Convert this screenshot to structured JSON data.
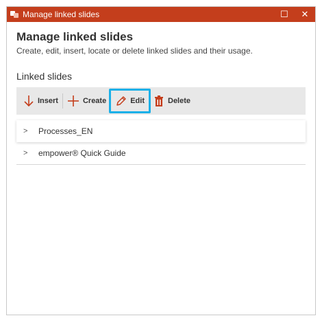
{
  "window": {
    "title": "Manage linked slides",
    "maximize_glyph": "☐",
    "close_glyph": "✕"
  },
  "dialog": {
    "heading": "Manage linked slides",
    "description": "Create, edit, insert, locate or delete linked slides and their usage.",
    "section_label": "Linked slides"
  },
  "toolbar": {
    "insert_label": "Insert",
    "create_label": "Create",
    "edit_label": "Edit",
    "delete_label": "Delete"
  },
  "tree": {
    "items": [
      {
        "label": "Processes_EN"
      },
      {
        "label": "empower® Quick Guide"
      }
    ]
  },
  "colors": {
    "titlebar": "#c43e1c",
    "highlight": "#1ab0e8",
    "toolbar_bg": "#e8e8e8",
    "icon_accent": "#c43e1c"
  },
  "icons": [
    "app-icon",
    "maximize-icon",
    "close-icon",
    "insert-arrow-icon",
    "plus-icon",
    "pencil-icon",
    "trash-icon",
    "chevron-right-icon"
  ]
}
